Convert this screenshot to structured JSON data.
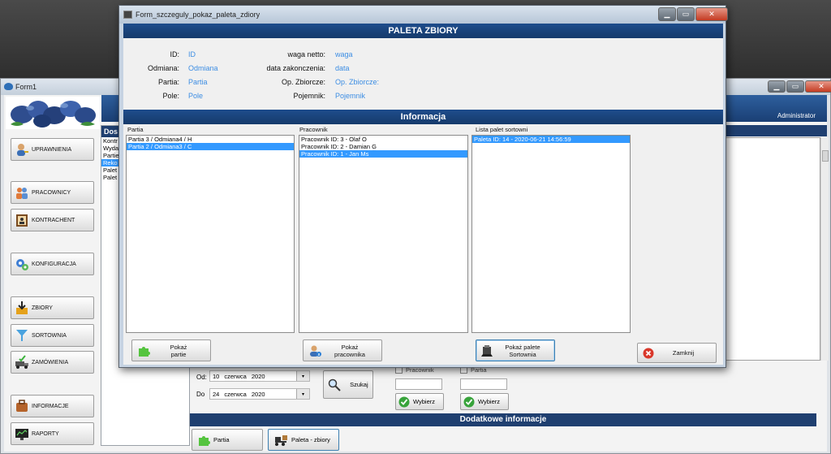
{
  "colors": {
    "accent": "#3399ff",
    "header": "#1f3f70",
    "value_text": "#3c8de3"
  },
  "main_window": {
    "title": "Form1",
    "user_label": "Administrator",
    "left_panel_header": "Dos",
    "left_list": [
      "Kontr",
      "Wyda",
      "Partie",
      "Reko",
      "Palet",
      "Palet"
    ],
    "left_list_selected": 3,
    "sidebar": [
      {
        "label": "UPRAWNIENIA",
        "icon": "user-key-icon"
      },
      {
        "label": "PRACOWNICY",
        "icon": "people-icon"
      },
      {
        "label": "KONTRACHENT",
        "icon": "contact-book-icon"
      },
      {
        "label": "KONFIGURACJA",
        "icon": "gears-icon"
      },
      {
        "label": "ZBIORY",
        "icon": "download-box-icon"
      },
      {
        "label": "SORTOWNIA",
        "icon": "funnel-icon"
      },
      {
        "label": "ZAMÓWIENIA",
        "icon": "truck-check-icon"
      },
      {
        "label": "INFORMACJE",
        "icon": "briefcase-icon"
      },
      {
        "label": "RAPORTY",
        "icon": "monitor-chart-icon"
      }
    ],
    "filters": {
      "from_label": "Od:",
      "from_day": "10",
      "from_month": "czerwca",
      "from_year": "2020",
      "to_label": "Do",
      "to_day": "24",
      "to_month": "czerwca",
      "to_year": "2020",
      "search_label": "Szukaj",
      "check_worker": "Pracownik",
      "check_batch": "Partia",
      "select_label": "Wybierz"
    },
    "extra_info_header": "Dodatkowe informacje",
    "bottom_buttons": {
      "batch": "Partia",
      "pallet": "Paleta - zbiory"
    }
  },
  "dialog": {
    "title": "Form_szczeguly_pokaz_paleta_zdiory",
    "header": "PALETA ZBIORY",
    "fields_left": [
      {
        "label": "ID:",
        "value": "ID"
      },
      {
        "label": "Odmiana:",
        "value": "Odmiana"
      },
      {
        "label": "Partia:",
        "value": "Partia"
      },
      {
        "label": "Pole:",
        "value": "Pole"
      }
    ],
    "fields_right": [
      {
        "label": "waga netto:",
        "value": "waga"
      },
      {
        "label": "data zakonczenia:",
        "value": "data"
      },
      {
        "label": "Op. Zbiorcze:",
        "value": "Op. Zbiorcze:"
      },
      {
        "label": "Pojemnik:",
        "value": "Pojemnik"
      }
    ],
    "info_header": "Informacja",
    "groups": {
      "batch": {
        "label": "Partia",
        "items": [
          "Partia 3 / Odmiana4 / H",
          "Partia 2 / Odmiana3 / C"
        ],
        "selected": 1,
        "button": [
          "Pokaż",
          "partie"
        ]
      },
      "worker": {
        "label": "Pracownik",
        "items": [
          "Pracownik ID: 3 - Olaf O",
          "Pracownik ID: 2 - Damian G",
          "Pracownik ID: 1 - Jan Ms"
        ],
        "selected": 2,
        "button": [
          "Pokaż",
          "pracownika"
        ]
      },
      "sort": {
        "label": "Lista palet sortowni",
        "items": [
          "Paleta ID: 14 - 2020-06-21 14:56:59"
        ],
        "selected": 0,
        "button": [
          "Pokaż palete",
          "Sortownia"
        ]
      }
    },
    "close_button": "Zamknij"
  }
}
